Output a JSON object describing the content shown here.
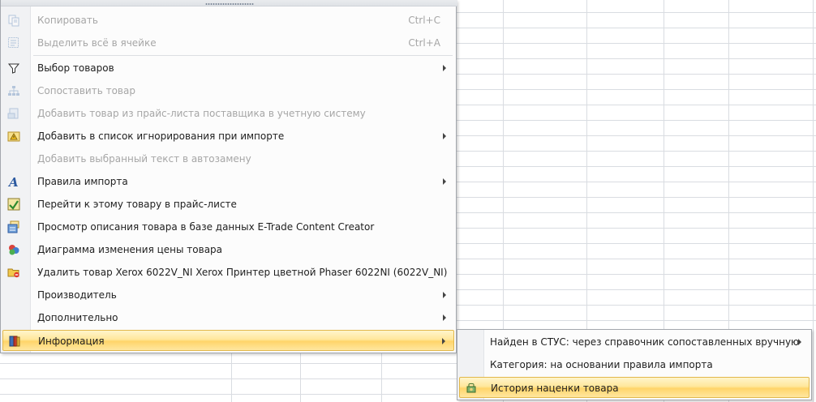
{
  "menu": {
    "items": [
      {
        "label": "Копировать",
        "shortcut": "Ctrl+C",
        "icon": "copy-icon",
        "disabled": true
      },
      {
        "label": "Выделить всё в ячейке",
        "shortcut": "Ctrl+A",
        "icon": "select-all-icon",
        "disabled": true
      },
      {
        "label": "Выбор товаров",
        "icon": "filter-icon",
        "submenu": true
      },
      {
        "label": "Сопоставить товар",
        "icon": "hierarchy-icon",
        "disabled": true
      },
      {
        "label": "Добавить товар из прайс-листа поставщика в учетную систему",
        "icon": "add-product-icon",
        "disabled": true
      },
      {
        "label": "Добавить в список игнорирования при импорте",
        "icon": "ignore-list-icon",
        "submenu": true
      },
      {
        "label": "Добавить выбранный текст в автозамену",
        "disabled": true
      },
      {
        "label": "Правила импорта",
        "icon": "rules-icon",
        "submenu": true
      },
      {
        "label": "Перейти к этому товару в прайс-листе",
        "icon": "goto-pricelist-icon"
      },
      {
        "label": "Просмотр описания товара в базе данных E-Trade Content Creator",
        "icon": "view-description-icon"
      },
      {
        "label": "Диаграмма изменения цены товара",
        "icon": "price-chart-icon"
      },
      {
        "label": "Удалить товар  Xerox 6022V_NI Xerox Принтер цветной Phaser 6022NI (6022V_NI)",
        "icon": "delete-folder-icon"
      },
      {
        "label": "Производитель",
        "submenu": true
      },
      {
        "label": "Дополнительно",
        "submenu": true
      },
      {
        "label": "Информация",
        "icon": "info-book-icon",
        "submenu": true,
        "highlighted": true
      }
    ]
  },
  "submenu": {
    "items": [
      {
        "label": "Найден в СТУС: через справочник сопоставленных вручную",
        "submenu": true
      },
      {
        "label": "Категория: на основании правила импорта"
      },
      {
        "label": "История наценки товара",
        "icon": "markup-history-icon",
        "highlighted": true
      }
    ]
  }
}
